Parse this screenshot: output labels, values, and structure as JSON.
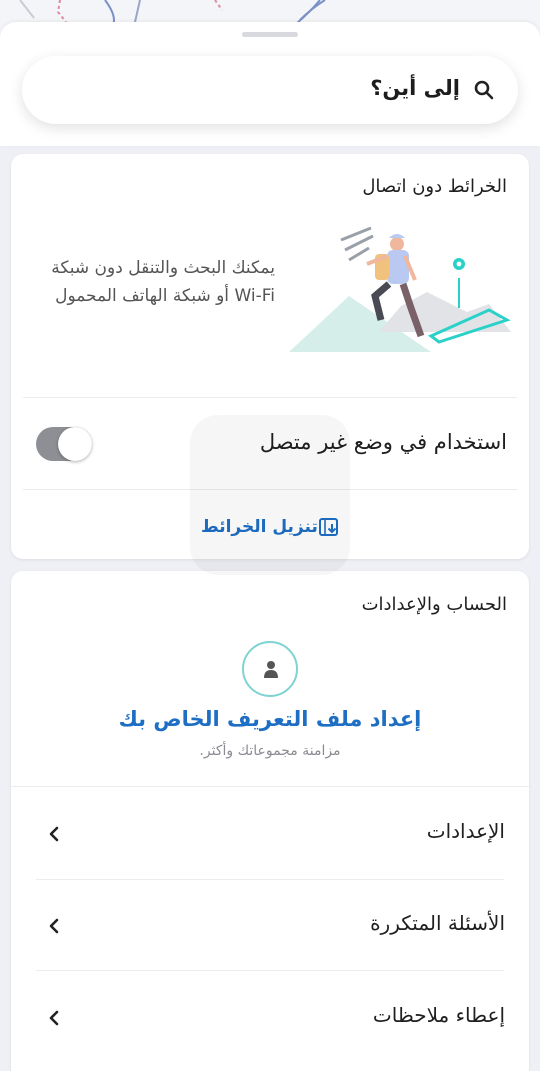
{
  "search": {
    "placeholder_label": "إلى أين؟",
    "icon": "search-icon"
  },
  "offline_card": {
    "title": "الخرائط دون اتصال",
    "description": "يمكنك البحث والتنقل دون شبكة Wi-Fi أو شبكة الهاتف المحمول",
    "toggle_label": "استخدام في وضع غير متصل",
    "toggle_on": false,
    "download_label": "تنزيل الخرائط",
    "download_icon": "download-map-icon"
  },
  "account_card": {
    "title": "الحساب والإعدادات",
    "avatar_icon": "person-icon",
    "profile_title": "إعداد ملف التعريف الخاص بك",
    "profile_subtitle": "مزامنة مجموعاتك وأكثر.",
    "menu": [
      {
        "label": "الإعدادات"
      },
      {
        "label": "الأسئلة المتكررة"
      },
      {
        "label": "إعطاء ملاحظات"
      }
    ]
  },
  "colors": {
    "accent": "#1e6ec4",
    "teal": "#2ad1c9",
    "toggle_off": "#8d8f95"
  }
}
